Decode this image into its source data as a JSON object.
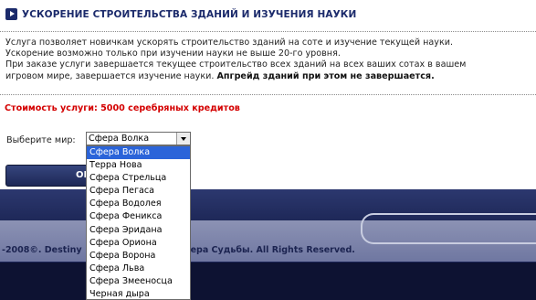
{
  "header": {
    "title": "УСКОРЕНИЕ СТРОИТЕЛЬСТВА ЗДАНИЙ И ИЗУЧЕНИЯ НАУКИ"
  },
  "description": {
    "line1": "Услуга позволяет новичкам ускорять строительство зданий на соте и изучение текущей науки.",
    "line2": "Ускорение возможно только при изучении науки не выше 20-го уровня.",
    "line3": "При заказе услуги завершается текущее строительство всех зданий на всех ваших сотах в вашем",
    "line4_plain": "игровом мире, завершается изучение науки.",
    "line4_bold": "Апгрейд зданий при этом не завершается."
  },
  "cost": {
    "text": "Стоимость услуги: 5000 серебряных кредитов"
  },
  "world": {
    "label": "Выберите мир:",
    "selected": "Сфера Волка",
    "options": [
      "Сфера Волка",
      "Терра Нова",
      "Сфера Стрельца",
      "Сфера Пегаса",
      "Сфера Водолея",
      "Сфера Феникса",
      "Сфера Эридана",
      "Сфера Ориона",
      "Сфера Ворона",
      "Сфера Льва",
      "Сфера Змееносца",
      "Черная дыра"
    ]
  },
  "order_button": {
    "label": "OI"
  },
  "footer": {
    "copy_left": "-2008©. Destiny",
    "copy_right": "Сфера Судьбы. All Rights Reserved."
  },
  "colors": {
    "accent": "#1b2a6b",
    "cost": "#d40000",
    "selected_option": "#2b64d9"
  }
}
